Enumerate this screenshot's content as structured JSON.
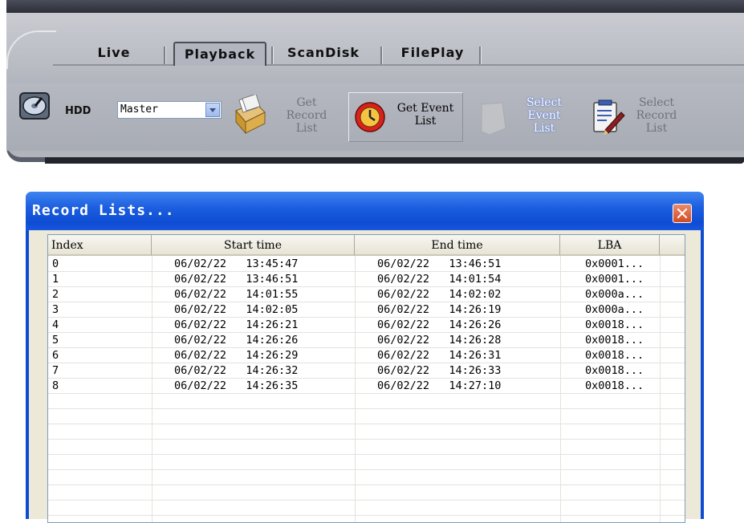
{
  "app": {
    "tabs": [
      {
        "label": "Live",
        "active": false
      },
      {
        "label": "Playback",
        "active": true
      },
      {
        "label": "ScanDisk",
        "active": false
      },
      {
        "label": "FilePlay",
        "active": false
      }
    ],
    "toolbar": {
      "hdd_label": "HDD",
      "hdd_select_value": "Master",
      "get_record_list": [
        "Get",
        "Record",
        "List"
      ],
      "get_event_list": [
        "Get Event",
        "List"
      ],
      "select_event_list": [
        "Select",
        "Event",
        "List"
      ],
      "select_record_list": [
        "Select",
        "Record",
        "List"
      ]
    }
  },
  "dialog": {
    "title": "Record Lists...",
    "columns": [
      "Index",
      "Start time",
      "End time",
      "LBA"
    ],
    "rows": [
      [
        "0",
        "06/02/22   13:45:47",
        "06/02/22   13:46:51",
        "0x0001..."
      ],
      [
        "1",
        "06/02/22   13:46:51",
        "06/02/22   14:01:54",
        "0x0001..."
      ],
      [
        "2",
        "06/02/22   14:01:55",
        "06/02/22   14:02:02",
        "0x000a..."
      ],
      [
        "3",
        "06/02/22   14:02:05",
        "06/02/22   14:26:19",
        "0x000a..."
      ],
      [
        "4",
        "06/02/22   14:26:21",
        "06/02/22   14:26:26",
        "0x0018..."
      ],
      [
        "5",
        "06/02/22   14:26:26",
        "06/02/22   14:26:28",
        "0x0018..."
      ],
      [
        "6",
        "06/02/22   14:26:29",
        "06/02/22   14:26:31",
        "0x0018..."
      ],
      [
        "7",
        "06/02/22   14:26:32",
        "06/02/22   14:26:33",
        "0x0018..."
      ],
      [
        "8",
        "06/02/22   14:26:35",
        "06/02/22   14:27:10",
        "0x0018..."
      ]
    ]
  }
}
